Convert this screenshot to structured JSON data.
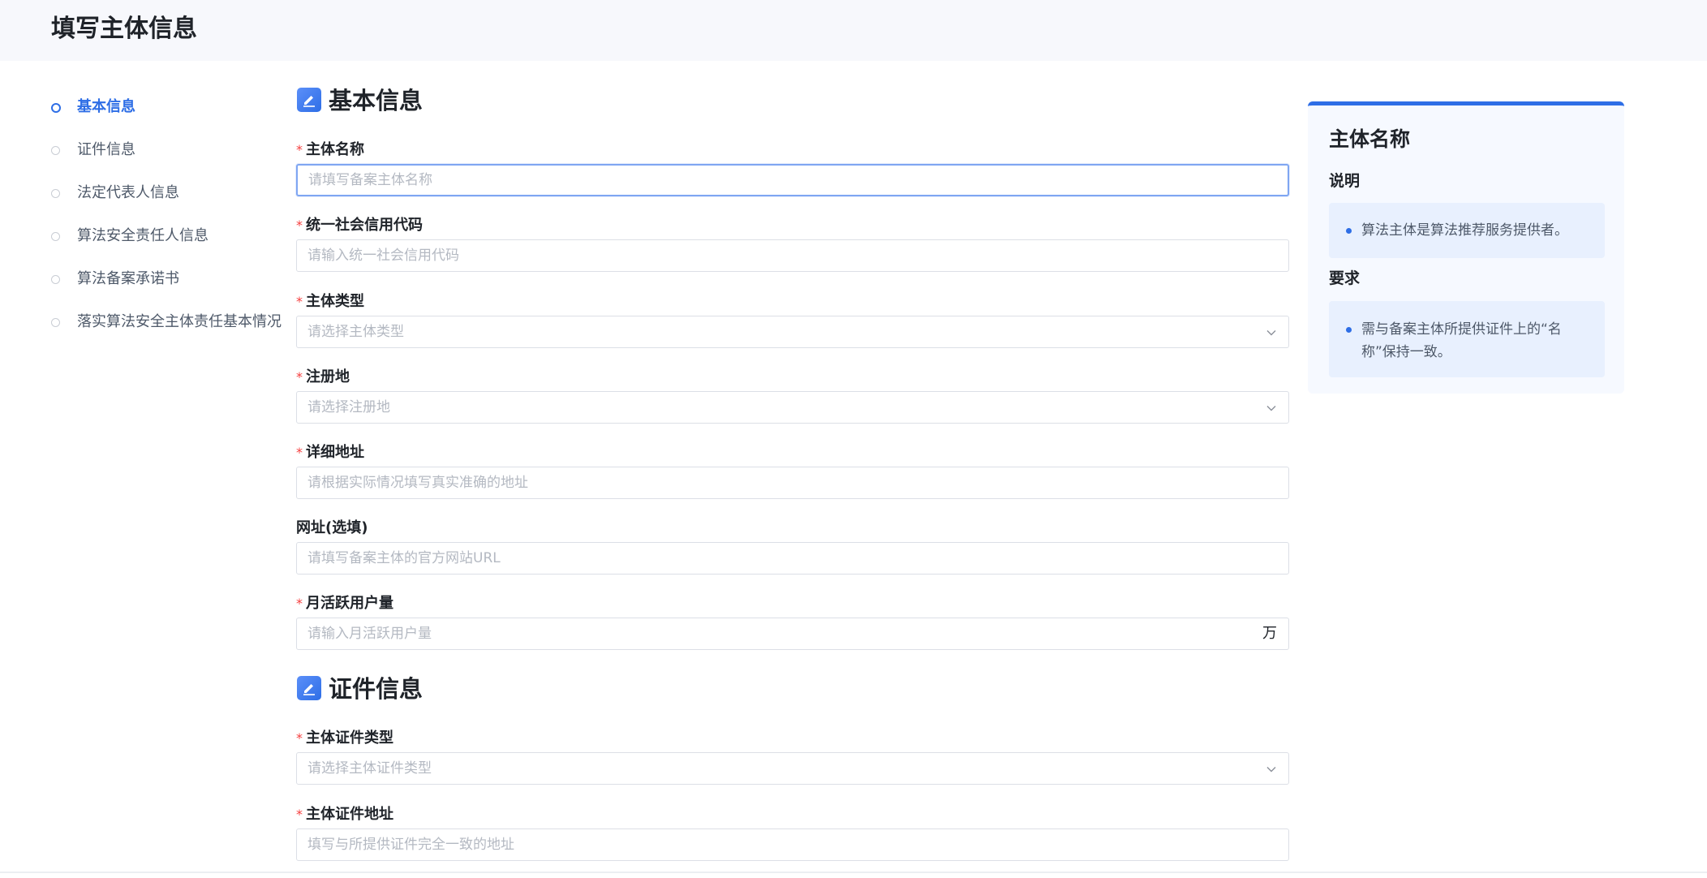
{
  "page": {
    "title": "填写主体信息"
  },
  "steps": [
    {
      "label": "基本信息",
      "active": true
    },
    {
      "label": "证件信息",
      "active": false
    },
    {
      "label": "法定代表人信息",
      "active": false
    },
    {
      "label": "算法安全责任人信息",
      "active": false
    },
    {
      "label": "算法备案承诺书",
      "active": false
    },
    {
      "label": "落实算法安全主体责任基本情况",
      "active": false
    }
  ],
  "sections": {
    "basic": {
      "title": "基本信息"
    },
    "cert": {
      "title": "证件信息"
    }
  },
  "fields": {
    "subject_name": {
      "label": "主体名称",
      "required": "*",
      "placeholder": "请填写备案主体名称",
      "value": ""
    },
    "credit_code": {
      "label": "统一社会信用代码",
      "required": "*",
      "placeholder": "请输入统一社会信用代码",
      "value": ""
    },
    "subject_type": {
      "label": "主体类型",
      "required": "*",
      "placeholder": "请选择主体类型",
      "value": ""
    },
    "reg_place": {
      "label": "注册地",
      "required": "*",
      "placeholder": "请选择注册地",
      "value": ""
    },
    "address": {
      "label": "详细地址",
      "required": "*",
      "placeholder": "请根据实际情况填写真实准确的地址",
      "value": ""
    },
    "website": {
      "label": "网址(选填)",
      "placeholder": "请填写备案主体的官方网站URL",
      "value": ""
    },
    "mau": {
      "label": "月活跃用户量",
      "required": "*",
      "placeholder": "请输入月活跃用户量",
      "value": "",
      "suffix": "万"
    },
    "cert_type": {
      "label": "主体证件类型",
      "required": "*",
      "placeholder": "请选择主体证件类型",
      "value": ""
    },
    "cert_address": {
      "label": "主体证件地址",
      "required": "*",
      "placeholder": "填写与所提供证件完全一致的地址",
      "value": ""
    }
  },
  "help": {
    "title": "主体名称",
    "explain_label": "说明",
    "explain_text": "算法主体是算法推荐服务提供者。",
    "require_label": "要求",
    "require_text": "需与备案主体所提供证件上的“名称”保持一致。"
  },
  "colors": {
    "accent": "#2e6ee6",
    "required": "#f53f3f",
    "help_bg": "#f6f9ff",
    "help_card_bg": "#e8f0fe"
  },
  "icons": {
    "section": "edit-icon",
    "select": "chevron-down-icon"
  }
}
